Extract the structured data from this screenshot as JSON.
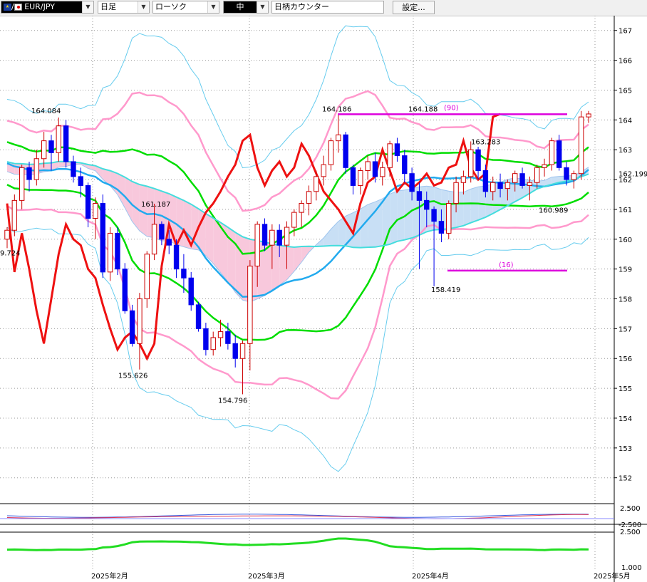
{
  "toolbar": {
    "symbol": "EUR/JPY",
    "flag_separator": "/",
    "period": "日足",
    "chart_type": "ローソク",
    "mode": "中",
    "counter_placeholder": "日柄カウンター",
    "settings_label": "設定..."
  },
  "chart_data": [
    {
      "type": "candlestick",
      "title": "",
      "x_ticks": [
        "2025年2月",
        "2025年3月",
        "2025年4月",
        "2025年5月"
      ],
      "y_ticks": [
        "152",
        "153",
        "154",
        "155",
        "156",
        "157",
        "158",
        "159",
        "160",
        "161",
        "162",
        "163",
        "164",
        "165",
        "166",
        "167"
      ],
      "ylim": [
        151.3,
        167.4
      ],
      "last_price": "162.199",
      "annotations": {
        "high_jan": "164.084",
        "low_jan": "9.724",
        "mid_feb": "161.187",
        "low_feb": "155.626",
        "low_mar": "154.796",
        "high_mar": "164.186",
        "high_apr": "164.188",
        "mid_apr": "163.283",
        "mid_apr_low": "160.989",
        "low_apr": "158.419",
        "count_upper": "(90)",
        "count_lower": "(16)"
      },
      "candles": [
        [
          160.0,
          160.4,
          159.7,
          160.3
        ],
        [
          160.3,
          161.5,
          160.1,
          161.3
        ],
        [
          161.3,
          162.5,
          161.0,
          162.4
        ],
        [
          162.4,
          162.6,
          161.6,
          162.0
        ],
        [
          162.0,
          163.0,
          161.8,
          162.7
        ],
        [
          162.7,
          163.6,
          162.4,
          163.3
        ],
        [
          163.3,
          163.5,
          162.3,
          162.9
        ],
        [
          162.9,
          164.08,
          162.6,
          163.8
        ],
        [
          163.8,
          164.0,
          162.4,
          162.6
        ],
        [
          162.6,
          162.8,
          161.9,
          162.1
        ],
        [
          162.1,
          162.4,
          161.4,
          161.8
        ],
        [
          161.8,
          161.9,
          160.4,
          160.7
        ],
        [
          160.7,
          161.4,
          160.0,
          161.2
        ],
        [
          161.2,
          161.5,
          158.7,
          158.9
        ],
        [
          158.9,
          160.4,
          158.6,
          160.2
        ],
        [
          160.2,
          160.4,
          158.8,
          159.0
        ],
        [
          159.0,
          159.2,
          157.5,
          157.6
        ],
        [
          157.6,
          157.8,
          156.4,
          156.5
        ],
        [
          156.5,
          158.2,
          155.63,
          158.0
        ],
        [
          158.0,
          159.6,
          157.7,
          159.5
        ],
        [
          159.5,
          161.19,
          159.3,
          160.5
        ],
        [
          160.5,
          160.6,
          159.8,
          160.0
        ],
        [
          160.0,
          160.3,
          159.5,
          159.8
        ],
        [
          159.8,
          160.0,
          158.7,
          159.0
        ],
        [
          159.0,
          159.5,
          158.2,
          158.7
        ],
        [
          158.7,
          158.9,
          157.6,
          157.8
        ],
        [
          157.8,
          157.9,
          156.9,
          157.0
        ],
        [
          157.0,
          157.2,
          156.1,
          156.3
        ],
        [
          156.3,
          156.9,
          156.1,
          156.7
        ],
        [
          156.7,
          157.3,
          156.4,
          156.9
        ],
        [
          156.9,
          157.2,
          156.3,
          156.5
        ],
        [
          156.5,
          156.8,
          155.7,
          156.0
        ],
        [
          156.0,
          156.6,
          154.8,
          156.5
        ],
        [
          156.5,
          159.3,
          155.6,
          159.1
        ],
        [
          159.1,
          160.6,
          158.4,
          160.5
        ],
        [
          160.5,
          160.7,
          159.6,
          159.8
        ],
        [
          159.8,
          160.5,
          159.0,
          160.3
        ],
        [
          160.3,
          160.5,
          159.4,
          159.8
        ],
        [
          159.8,
          160.6,
          159.0,
          160.4
        ],
        [
          160.4,
          161.0,
          160.1,
          160.9
        ],
        [
          160.9,
          161.3,
          160.4,
          161.2
        ],
        [
          161.2,
          161.8,
          160.8,
          161.6
        ],
        [
          161.6,
          162.3,
          161.3,
          162.1
        ],
        [
          162.1,
          162.8,
          161.8,
          162.5
        ],
        [
          162.5,
          163.4,
          162.3,
          163.3
        ],
        [
          163.3,
          164.19,
          162.9,
          163.5
        ],
        [
          163.5,
          163.6,
          162.2,
          162.4
        ],
        [
          162.4,
          162.5,
          161.5,
          161.8
        ],
        [
          161.8,
          162.4,
          161.5,
          162.3
        ],
        [
          162.3,
          162.8,
          162.0,
          162.6
        ],
        [
          162.6,
          162.9,
          161.9,
          162.1
        ],
        [
          162.1,
          162.6,
          161.8,
          162.4
        ],
        [
          162.4,
          163.3,
          162.1,
          163.2
        ],
        [
          163.2,
          163.4,
          162.6,
          162.8
        ],
        [
          162.8,
          163.0,
          161.9,
          162.2
        ],
        [
          162.2,
          162.4,
          161.3,
          161.6
        ],
        [
          161.6,
          161.9,
          159.0,
          161.3
        ],
        [
          161.3,
          161.6,
          160.4,
          161.0
        ],
        [
          161.0,
          161.1,
          158.42,
          160.6
        ],
        [
          160.6,
          161.0,
          159.9,
          160.2
        ],
        [
          160.2,
          161.3,
          160.0,
          161.2
        ],
        [
          161.2,
          162.1,
          160.9,
          161.9
        ],
        [
          161.9,
          162.3,
          161.5,
          162.1
        ],
        [
          162.1,
          163.28,
          161.9,
          163.0
        ],
        [
          163.0,
          163.1,
          162.0,
          162.3
        ],
        [
          162.3,
          162.5,
          161.4,
          161.6
        ],
        [
          161.6,
          162.1,
          161.3,
          161.9
        ],
        [
          161.9,
          162.2,
          161.4,
          161.7
        ],
        [
          161.7,
          162.0,
          161.3,
          161.9
        ],
        [
          161.9,
          162.3,
          161.6,
          162.2
        ],
        [
          162.2,
          162.4,
          161.7,
          161.8
        ],
        [
          161.8,
          162.1,
          161.3,
          161.9
        ],
        [
          161.9,
          162.5,
          161.7,
          162.4
        ],
        [
          162.4,
          162.7,
          162.1,
          162.5
        ],
        [
          162.5,
          163.4,
          162.3,
          163.3
        ],
        [
          163.3,
          163.5,
          162.3,
          162.4
        ],
        [
          162.4,
          162.6,
          161.8,
          162.0
        ],
        [
          162.0,
          162.3,
          161.7,
          162.2
        ],
        [
          162.2,
          164.3,
          162.0,
          164.1
        ],
        [
          164.1,
          164.3,
          163.9,
          164.2
        ]
      ]
    },
    {
      "type": "line",
      "y_ticks": [
        "2.500",
        "-2.500"
      ]
    },
    {
      "type": "line",
      "y_ticks": [
        "2.500",
        "1.000"
      ]
    }
  ],
  "colors": {
    "up_candle": "#cc0000",
    "down_candle": "#0000ee",
    "bb_outer": "#66ccee",
    "bb_mid": "#ff99cc",
    "bb_inner": "#00dd00",
    "ma_blue": "#22aaee",
    "ma_cyan": "#44dddd",
    "chikou": "#ee1111",
    "kumo_up": "#c8dff5",
    "kumo_down": "#f8c8dc",
    "counter_line": "#dd00dd"
  }
}
